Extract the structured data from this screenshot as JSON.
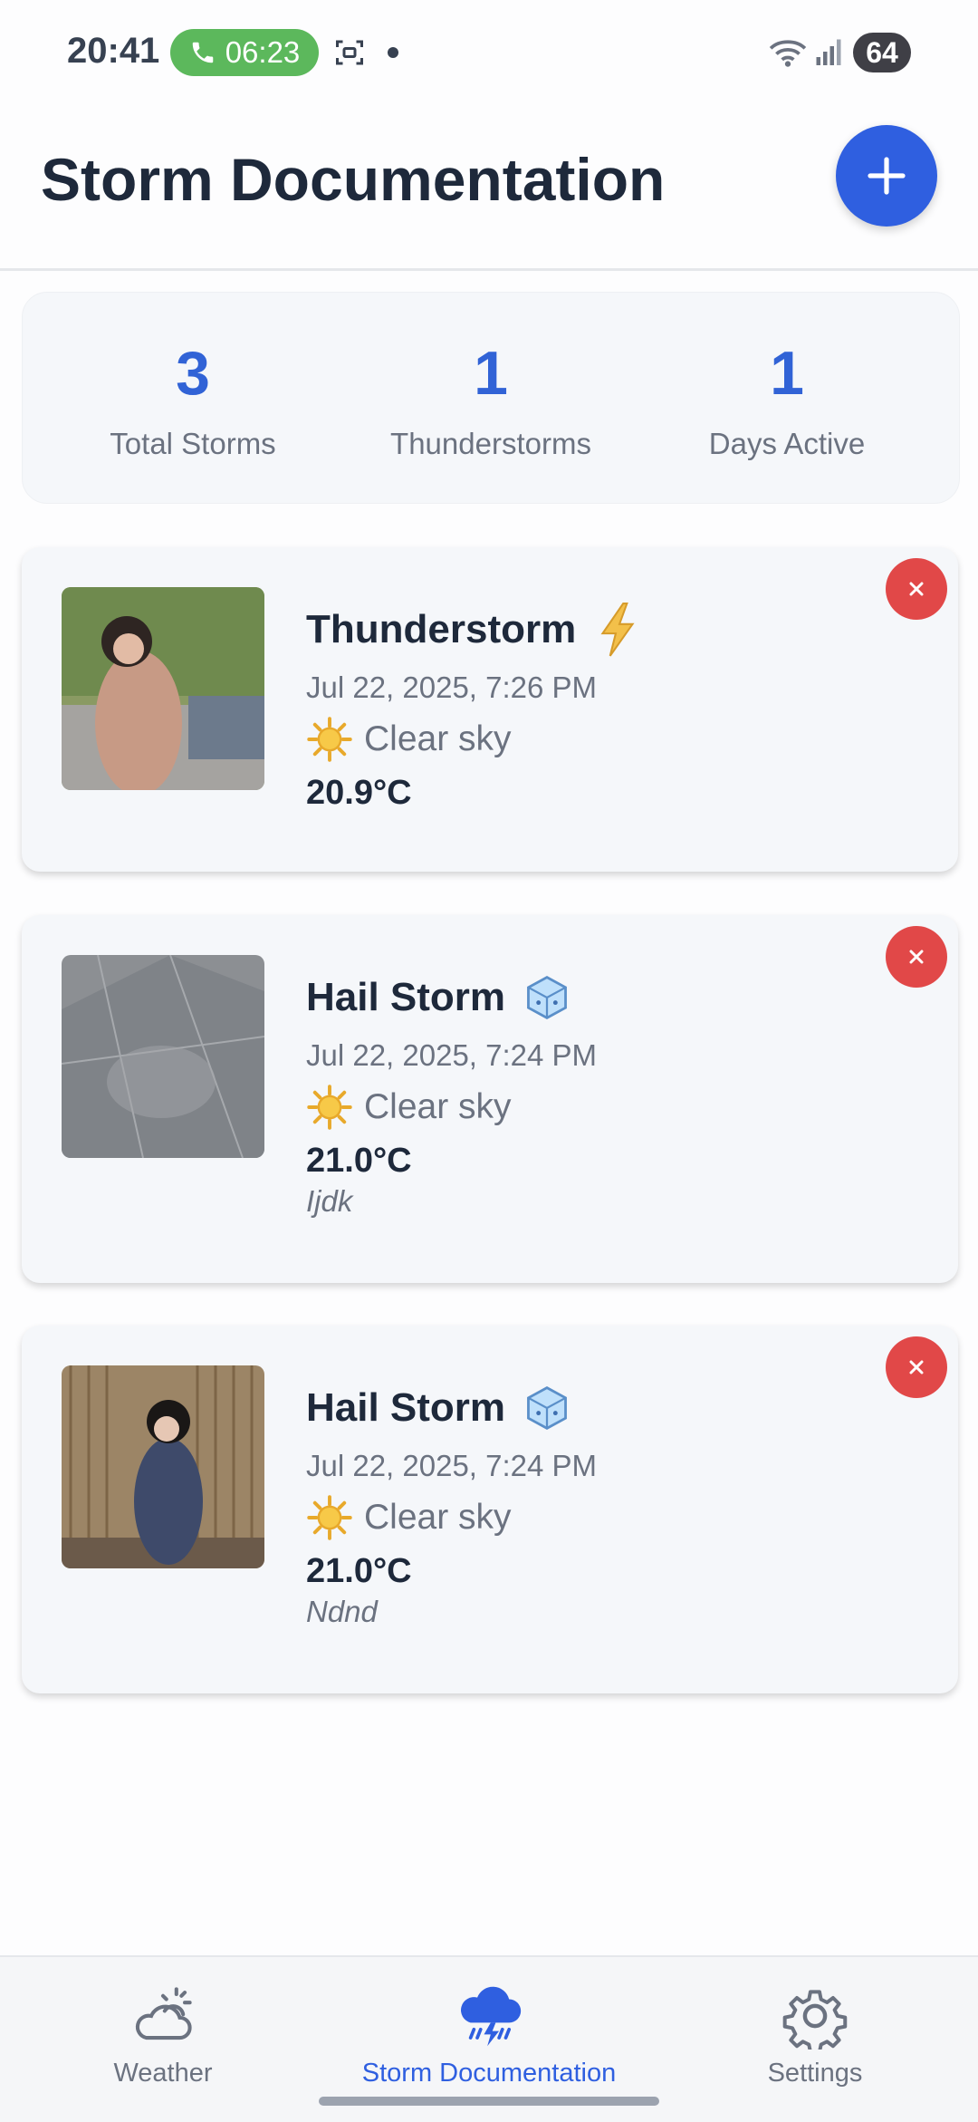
{
  "status_bar": {
    "time": "20:41",
    "call_timer": "06:23",
    "battery": "64"
  },
  "header": {
    "title": "Storm Documentation",
    "add_icon": "plus-icon"
  },
  "stats": [
    {
      "value": "3",
      "label": "Total Storms"
    },
    {
      "value": "1",
      "label": "Thunderstorms"
    },
    {
      "value": "1",
      "label": "Days Active"
    }
  ],
  "storms": [
    {
      "type": "Thunderstorm",
      "type_icon": "lightning-icon",
      "date": "Jul 22, 2025, 7:26 PM",
      "weather": "Clear sky",
      "weather_icon": "sun-icon",
      "temperature": "20.9°C",
      "note": ""
    },
    {
      "type": "Hail Storm",
      "type_icon": "ice-cube-icon",
      "date": "Jul 22, 2025, 7:24 PM",
      "weather": "Clear sky",
      "weather_icon": "sun-icon",
      "temperature": "21.0°C",
      "note": "Ijdk"
    },
    {
      "type": "Hail Storm",
      "type_icon": "ice-cube-icon",
      "date": "Jul 22, 2025, 7:24 PM",
      "weather": "Clear sky",
      "weather_icon": "sun-icon",
      "temperature": "21.0°C",
      "note": "Ndnd"
    }
  ],
  "nav": [
    {
      "label": "Weather",
      "icon": "cloud-sun-icon",
      "active": false
    },
    {
      "label": "Storm Documentation",
      "icon": "storm-cloud-icon",
      "active": true
    },
    {
      "label": "Settings",
      "icon": "gear-icon",
      "active": false
    }
  ],
  "colors": {
    "accent": "#2f5fe0",
    "delete": "#e14848",
    "call_pill": "#5cb85c"
  }
}
